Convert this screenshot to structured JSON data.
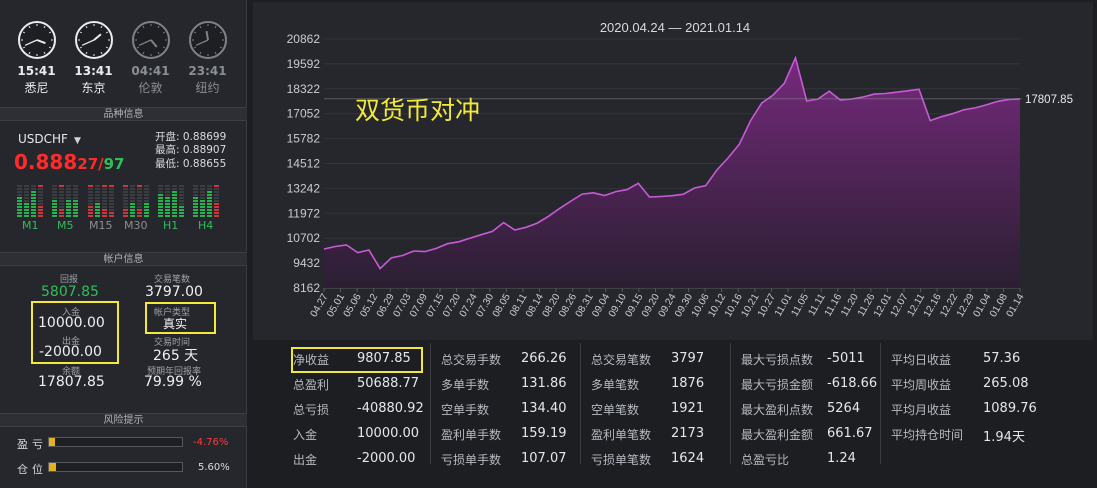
{
  "clocks": [
    {
      "time": "15:41",
      "city": "悉尼",
      "active": true,
      "hour": 15,
      "minute": 41
    },
    {
      "time": "13:41",
      "city": "东京",
      "active": true,
      "hour": 13,
      "minute": 41
    },
    {
      "time": "04:41",
      "city": "伦敦",
      "active": false,
      "hour": 4,
      "minute": 41
    },
    {
      "time": "23:41",
      "city": "纽约",
      "active": false,
      "hour": 23,
      "minute": 41
    }
  ],
  "sections": {
    "symbol_info": "品种信息",
    "account_info": "帐户信息",
    "risk": "风险提示"
  },
  "symbol": {
    "name": "USDCHF",
    "price_main": "0.888",
    "price_mid": "27",
    "price_slash": "/",
    "price_tail": "97",
    "open": "开盘: 0.88699",
    "high": "最高: 0.88907",
    "low": "最低: 0.88655"
  },
  "timeframes": [
    {
      "label": "M1",
      "active": true
    },
    {
      "label": "M5",
      "active": true
    },
    {
      "label": "M15",
      "active": false
    },
    {
      "label": "M30",
      "active": false
    },
    {
      "label": "H1",
      "active": true
    },
    {
      "label": "H4",
      "active": true
    }
  ],
  "account": {
    "return_label": "回报",
    "return_value": "5807.85",
    "trades_label": "交易笔数",
    "trades_value": "3797.00",
    "deposit_label": "入金",
    "deposit_value": "10000.00",
    "withdraw_label": "出金",
    "withdraw_value": "-2000.00",
    "type_label": "帐户类型",
    "type_value": "真实",
    "time_label": "交易时间",
    "time_value": "265 天",
    "balance_label": "余额",
    "balance_value": "17807.85",
    "winrate_label": "预期年回报率",
    "winrate_value": "79.99 %"
  },
  "risk": [
    {
      "label": "盈亏",
      "pct": "-4.76%",
      "level": 0.0476,
      "color": "#ff3b3b"
    },
    {
      "label": "仓位",
      "pct": "5.60%",
      "level": 0.056,
      "color": "#d8dbe0"
    }
  ],
  "chart_data": {
    "type": "area",
    "title": "2020.04.24 — 2021.01.14",
    "annotation": "双货币对冲",
    "last_value_label": "17807.85",
    "yticks": [
      "20862",
      "19592",
      "18322",
      "17052",
      "15782",
      "14512",
      "13242",
      "11972",
      "10702",
      "9432",
      "8162"
    ],
    "ylim": [
      8162,
      20862
    ],
    "xticks": [
      "04.27",
      "05.01",
      "05.06",
      "05.12",
      "06.29",
      "07.03",
      "07.09",
      "07.15",
      "07.20",
      "07.24",
      "07.30",
      "08.05",
      "08.11",
      "08.14",
      "08.20",
      "08.26",
      "08.31",
      "09.04",
      "09.10",
      "09.15",
      "09.20",
      "09.24",
      "09.30",
      "10.06",
      "10.12",
      "10.16",
      "10.21",
      "10.27",
      "11.01",
      "11.05",
      "11.11",
      "11.16",
      "11.20",
      "11.26",
      "12.01",
      "12.07",
      "12.11",
      "12.16",
      "12.22",
      "12.29",
      "01.04",
      "01.08",
      "01.14"
    ],
    "values": [
      10150,
      10280,
      10360,
      9960,
      10100,
      9150,
      9700,
      9820,
      10050,
      10020,
      10180,
      10420,
      10520,
      10700,
      10880,
      11050,
      11500,
      11120,
      11260,
      11470,
      11820,
      12220,
      12600,
      12950,
      13020,
      12880,
      13080,
      13180,
      13500,
      12800,
      12830,
      12870,
      12940,
      13260,
      13380,
      14180,
      14800,
      15500,
      16700,
      17600,
      18000,
      18600,
      19900,
      17700,
      17800,
      18200,
      17750,
      17800,
      17900,
      18050,
      18080,
      18150,
      18220,
      18300,
      16700,
      16900,
      17050,
      17250,
      17350,
      17500,
      17680,
      17780,
      17807.85
    ]
  },
  "stats": [
    [
      {
        "label": "净收益",
        "value": "9807.85"
      },
      {
        "label": "总盈利",
        "value": "50688.77"
      },
      {
        "label": "总亏损",
        "value": "-40880.92"
      },
      {
        "label": "入金",
        "value": "10000.00"
      },
      {
        "label": "出金",
        "value": "-2000.00"
      }
    ],
    [
      {
        "label": "总交易手数",
        "value": "266.26"
      },
      {
        "label": "多单手数",
        "value": "131.86"
      },
      {
        "label": "空单手数",
        "value": "134.40"
      },
      {
        "label": "盈利单手数",
        "value": "159.19"
      },
      {
        "label": "亏损单手数",
        "value": "107.07"
      }
    ],
    [
      {
        "label": "总交易笔数",
        "value": "3797"
      },
      {
        "label": "多单笔数",
        "value": "1876"
      },
      {
        "label": "空单笔数",
        "value": "1921"
      },
      {
        "label": "盈利单笔数",
        "value": "2173"
      },
      {
        "label": "亏损单笔数",
        "value": "1624"
      }
    ],
    [
      {
        "label": "最大亏损点数",
        "value": "-5011"
      },
      {
        "label": "最大亏损金额",
        "value": "-618.66"
      },
      {
        "label": "最大盈利点数",
        "value": "5264"
      },
      {
        "label": "最大盈利金额",
        "value": "661.67"
      },
      {
        "label": "总盈亏比",
        "value": "1.24"
      }
    ],
    [
      {
        "label": "平均日收益",
        "value": "57.36"
      },
      {
        "label": "平均周收益",
        "value": "265.08"
      },
      {
        "label": "平均月收益",
        "value": "1089.76"
      },
      {
        "label": "平均持仓时间",
        "value": "1.94天"
      }
    ]
  ],
  "colors": {
    "line": "#c85ad8",
    "fill_top": "#7a2a80",
    "fill_bottom": "#2b1e33",
    "highlight": "#f2e93a",
    "up": "#2fbf5a",
    "down": "#ff2b2b"
  }
}
